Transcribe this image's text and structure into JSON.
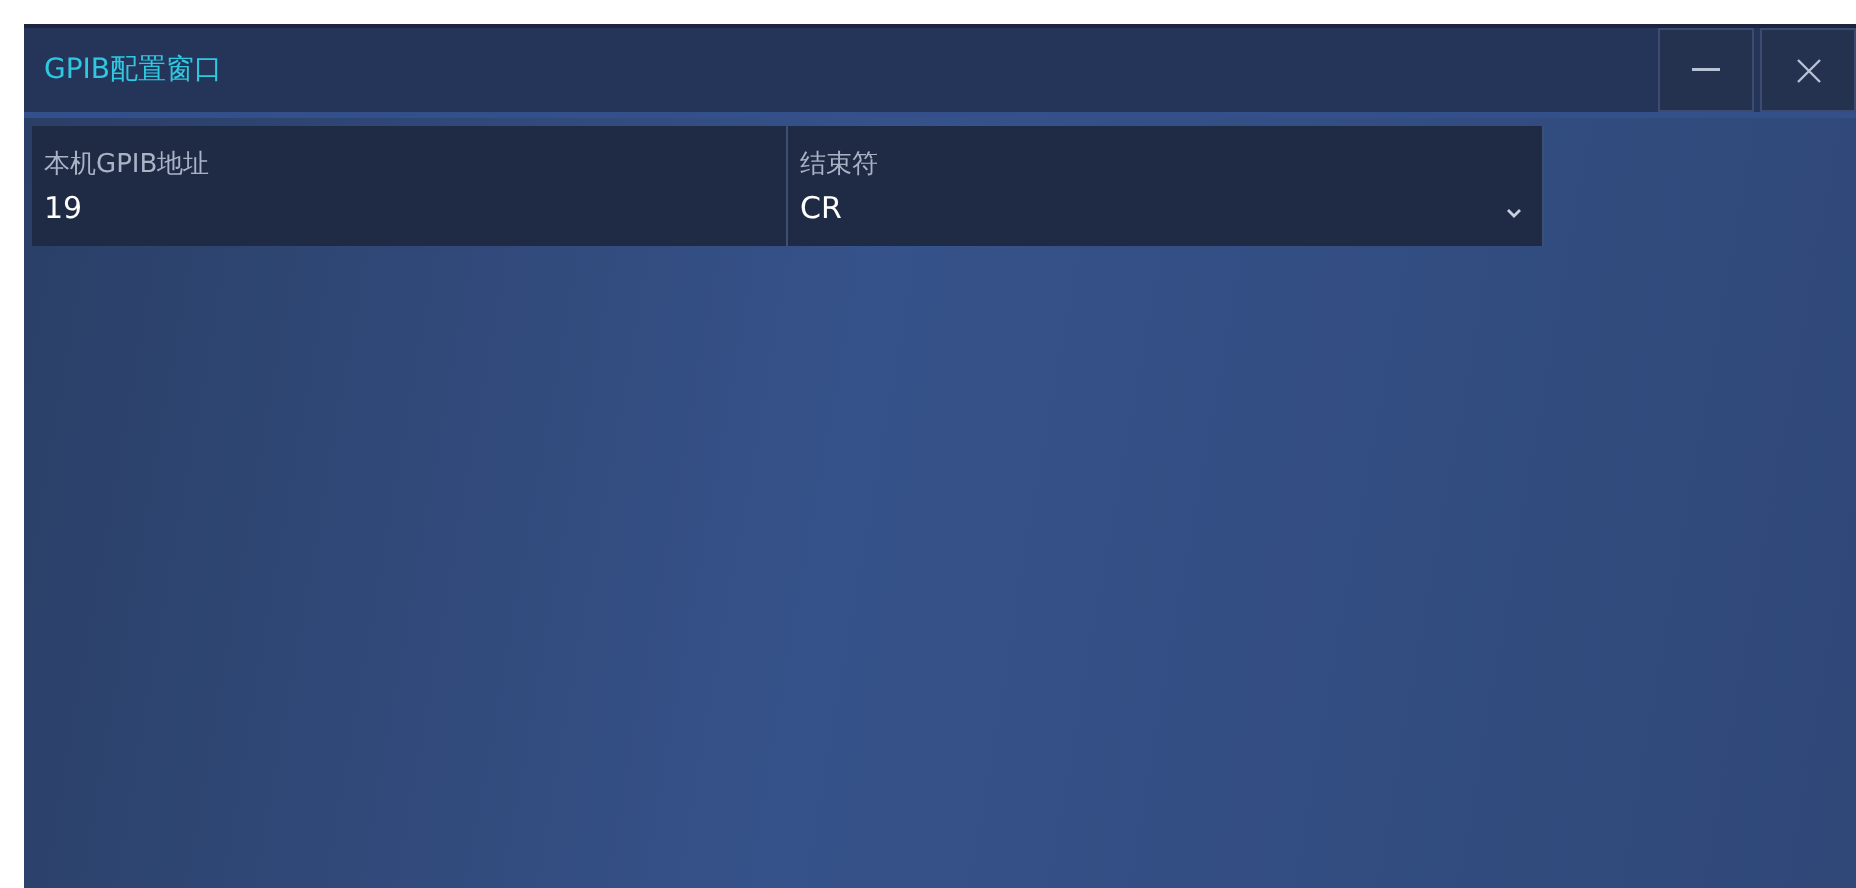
{
  "window": {
    "title": "GPIB配置窗口"
  },
  "fields": [
    {
      "kind": "text",
      "label": "本机GPIB地址",
      "value": "19"
    },
    {
      "kind": "select",
      "label": "结束符",
      "value": "CR"
    }
  ]
}
